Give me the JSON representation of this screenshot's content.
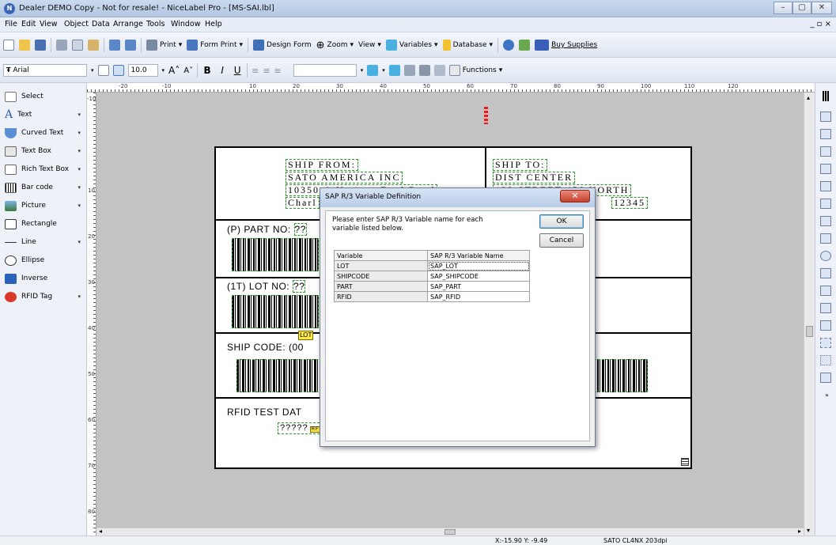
{
  "window": {
    "title": "Dealer DEMO Copy - Not for resale! - NiceLabel Pro - [MS-SAI.lbl]",
    "app_icon_glyph": "N",
    "minimize": "–",
    "maximize": "▢",
    "close": "✕",
    "mdi_controls": "_ ▫ ×"
  },
  "menu": [
    "File",
    "Edit",
    "View",
    "Object",
    "Data",
    "Arrange",
    "Tools",
    "Window",
    "Help"
  ],
  "toolbar1": {
    "print": "Print",
    "form_print": "Form Print",
    "design_form": "Design Form",
    "zoom": "Zoom",
    "view": "View",
    "variables": "Variables",
    "database": "Database",
    "buy_supplies": "Buy Supplies"
  },
  "toolbar2": {
    "font": "Arial",
    "size": "10.0",
    "bold": "B",
    "italic": "I",
    "underline": "U",
    "functions": "Functions"
  },
  "tools": [
    {
      "label": "Select",
      "icon": "pointer-icon"
    },
    {
      "label": "Text",
      "icon": "text-icon",
      "dropdown": true
    },
    {
      "label": "Curved Text",
      "icon": "curved-text-icon",
      "dropdown": true
    },
    {
      "label": "Text Box",
      "icon": "text-box-icon",
      "dropdown": true
    },
    {
      "label": "Rich Text Box",
      "icon": "rich-text-icon",
      "dropdown": true
    },
    {
      "label": "Bar code",
      "icon": "barcode-icon",
      "dropdown": true
    },
    {
      "label": "Picture",
      "icon": "picture-icon",
      "dropdown": true
    },
    {
      "label": "Rectangle",
      "icon": "rectangle-icon"
    },
    {
      "label": "Line",
      "icon": "line-icon",
      "dropdown": true
    },
    {
      "label": "Ellipse",
      "icon": "ellipse-icon"
    },
    {
      "label": "Inverse",
      "icon": "inverse-icon"
    },
    {
      "label": "RFID Tag",
      "icon": "rfid-icon",
      "dropdown": true
    }
  ],
  "ruler": {
    "h_labels": [
      "-20",
      "-10",
      "10",
      "20",
      "30",
      "40",
      "50",
      "60",
      "70",
      "80",
      "90",
      "100",
      "110",
      "120"
    ],
    "v_labels": [
      "-10",
      "10",
      "20",
      "30",
      "40",
      "50",
      "60",
      "70",
      "80"
    ]
  },
  "label": {
    "ship_from_title": "SHIP FROM:",
    "ship_from_line1": "SATO AMERICA INC",
    "ship_from_line2": "10350-A Nations Ford Road",
    "ship_from_line3": "Charl",
    "ship_to_title": "SHIP TO:",
    "ship_to_line1": "DIST CENTER",
    "ship_to_line2": "123 STREET 456 NORTH",
    "ship_to_line3": "12345",
    "part_no": "(P) PART NO:",
    "part_no_value": "??",
    "lot_no": "(1T) LOT NO:",
    "lot_no_value": "??",
    "lot_tag": "LOT",
    "ship_code": "SHIP CODE: (00",
    "rfid_title": "RFID TEST DAT",
    "rfid_value_left": "?????",
    "rfid_value_right": "?????",
    "rfid_tag": "RFID"
  },
  "dialog": {
    "title": "SAP R/3 Variable Definition",
    "close": "✕",
    "instructions": "Please enter SAP R/3 Variable name for each variable listed below.",
    "ok": "OK",
    "cancel": "Cancel",
    "col_variable": "Variable",
    "col_sap": "SAP R/3 Variable Name",
    "rows": [
      {
        "variable": "LOT",
        "sap": "SAP_LOT"
      },
      {
        "variable": "SHIPCODE",
        "sap": "SAP_SHIPCODE"
      },
      {
        "variable": "PART",
        "sap": "SAP_PART"
      },
      {
        "variable": "RFID",
        "sap": "SAP_RFID"
      }
    ]
  },
  "status": {
    "coords": "X:-15.90 Y: -9.49",
    "printer": "SATO CL4NX 203dpi"
  },
  "colors": {
    "accent": "#3a64b8",
    "selection_dash": "#2b9a2b",
    "field_tag": "#ffe94a",
    "workspace": "#c3c3c3"
  }
}
